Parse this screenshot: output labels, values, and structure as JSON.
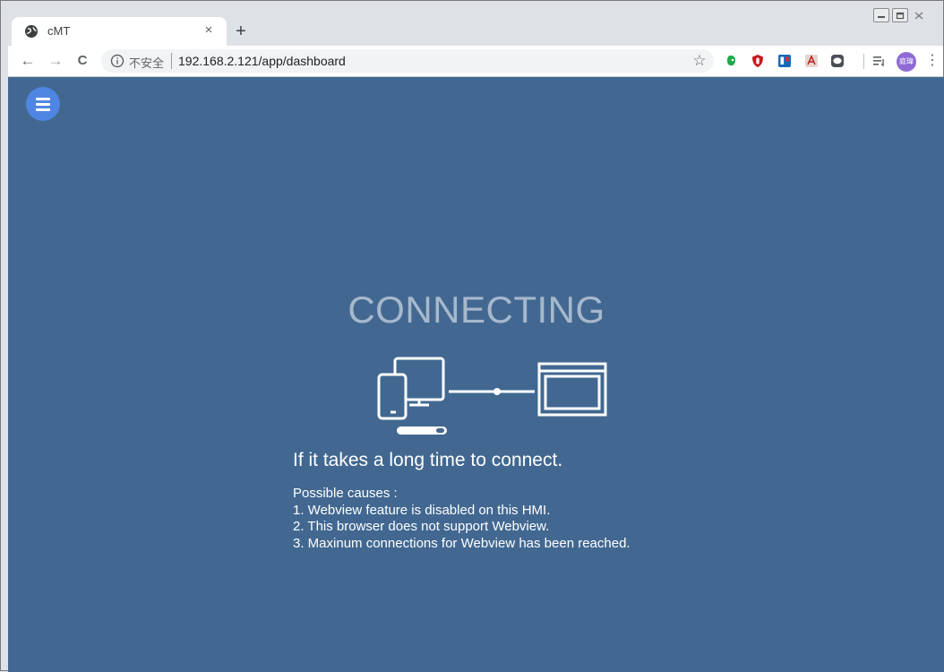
{
  "browser": {
    "tab": {
      "title": "cMT",
      "favicon": "globe-icon",
      "close_label": "×"
    },
    "new_tab_label": "+",
    "toolbar": {
      "back_label": "←",
      "forward_label": "→",
      "reload_label": "C",
      "security_label": "不安全",
      "url": "192.168.2.121/app/dashboard",
      "bookmark_label": "☆",
      "menu_label": "⋮",
      "avatar_label": "庭瑋"
    },
    "extensions": [
      "evernote-icon",
      "ublock-icon",
      "trello-icon",
      "pdf-icon",
      "line-icon",
      "reading-list-icon"
    ]
  },
  "page": {
    "status_title": "CONNECTING",
    "help_heading": "If it takes a long time to connect.",
    "causes_heading": "Possible causes :",
    "causes": [
      "1. Webview feature is disabled on this HMI.",
      "2. This browser does not support Webview.",
      "3. Maxinum connections for Webview has been reached."
    ]
  },
  "colors": {
    "page_background": "#426891",
    "menu_button": "#4f86e3",
    "status_title": "#a7b8cd",
    "text": "#ffffff"
  }
}
